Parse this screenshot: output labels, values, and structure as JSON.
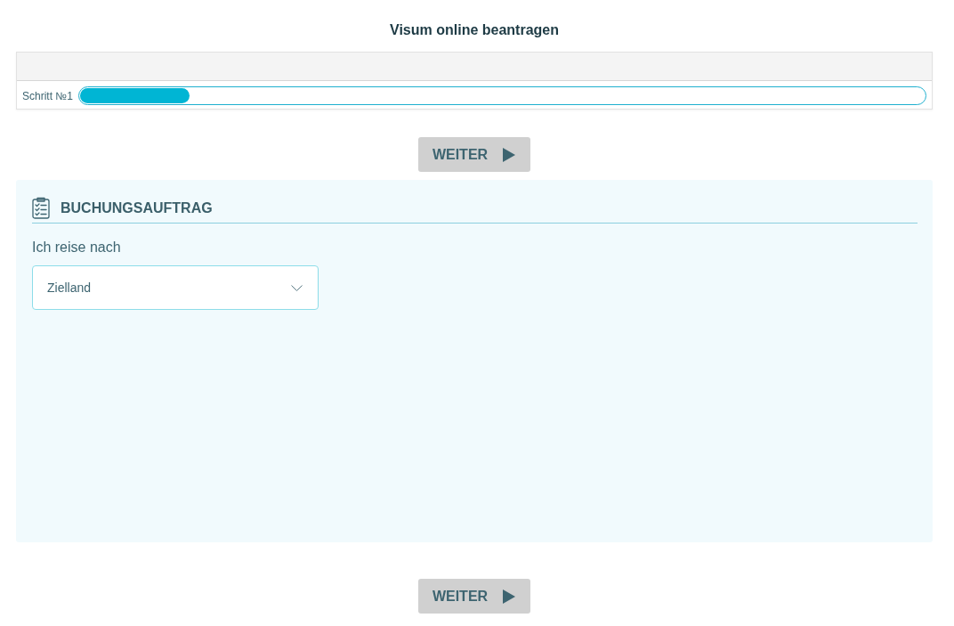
{
  "page": {
    "title": "Visum online beantragen"
  },
  "progress": {
    "step_label": "Schritt №1",
    "level": 0.13
  },
  "top_button": {
    "label": "WEITER"
  },
  "booking": {
    "title": "BUCHUNGSAUFTRAG",
    "destination": {
      "label": "Ich reise nach",
      "value": "Zielland"
    }
  },
  "bottom_button": {
    "label": "WEITER"
  }
}
